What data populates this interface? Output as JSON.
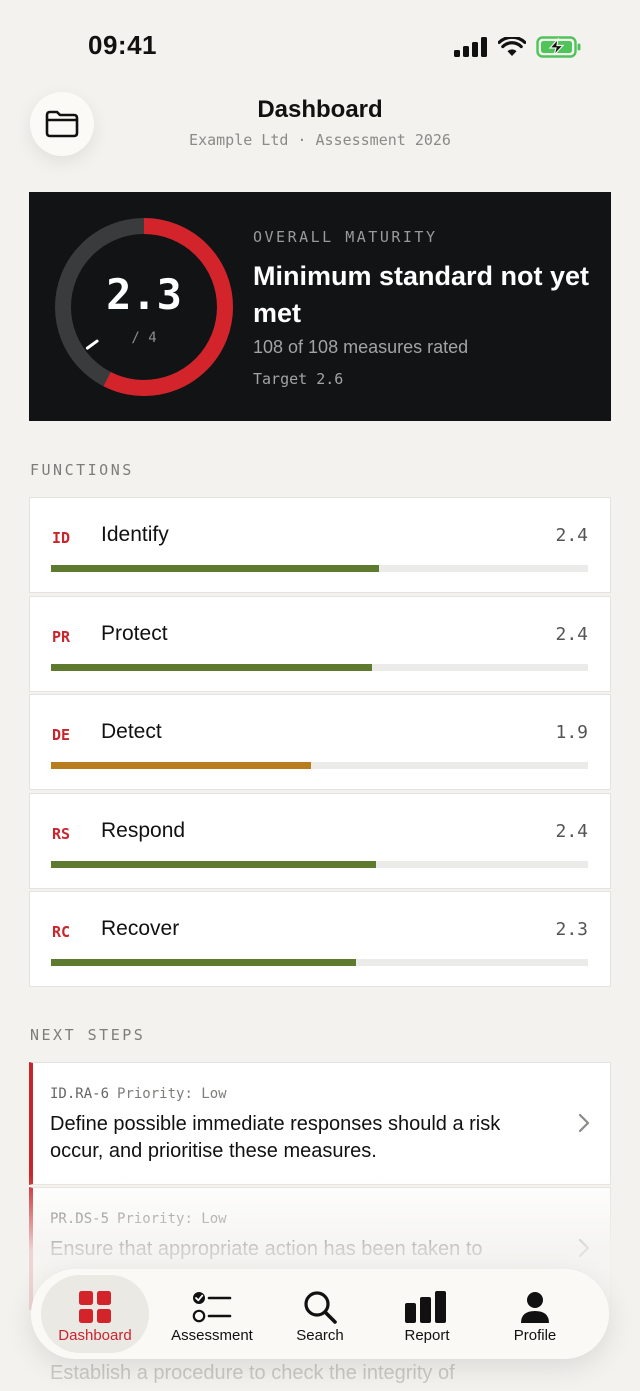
{
  "status": {
    "time": "09:41"
  },
  "header": {
    "title": "Dashboard",
    "subtitle": "Example Ltd · Assessment 2026"
  },
  "maturity": {
    "label": "OVERALL MATURITY",
    "score": "2.3",
    "score_of": "/ 4",
    "score_value": 2.3,
    "score_max": 4,
    "target_value": 2.6,
    "headline": "Minimum standard not yet met",
    "rated": "108 of 108 measures rated",
    "target": "Target 2.6"
  },
  "functions": {
    "label": "FUNCTIONS",
    "items": [
      {
        "code": "ID",
        "name": "Identify",
        "score": "2.4",
        "progress": 0.61,
        "color": "#5d7a2f"
      },
      {
        "code": "PR",
        "name": "Protect",
        "score": "2.4",
        "progress": 0.597,
        "color": "#5d7a2f"
      },
      {
        "code": "DE",
        "name": "Detect",
        "score": "1.9",
        "progress": 0.485,
        "color": "#b87d1e"
      },
      {
        "code": "RS",
        "name": "Respond",
        "score": "2.4",
        "progress": 0.605,
        "color": "#5d7a2f"
      },
      {
        "code": "RC",
        "name": "Recover",
        "score": "2.3",
        "progress": 0.568,
        "color": "#5d7a2f"
      }
    ]
  },
  "next_steps": {
    "label": "NEXT STEPS",
    "items": [
      {
        "code": "ID.RA-6",
        "priority": "Priority: Low",
        "text": "Define possible immediate responses should a risk occur, and prioritise these measures."
      },
      {
        "code": "PR.DS-5",
        "priority": "Priority: Low",
        "text": "Ensure that appropriate action has been taken to"
      }
    ],
    "partial_text": "Establish a procedure to check the integrity of"
  },
  "tabs": [
    {
      "label": "Dashboard",
      "icon": "grid-icon",
      "active": true
    },
    {
      "label": "Assessment",
      "icon": "checklist-icon",
      "active": false
    },
    {
      "label": "Search",
      "icon": "search-icon",
      "active": false
    },
    {
      "label": "Report",
      "icon": "bar-chart-icon",
      "active": false
    },
    {
      "label": "Profile",
      "icon": "person-icon",
      "active": false
    }
  ],
  "colors": {
    "accent": "#c9252c",
    "good": "#5d7a2f",
    "warn": "#b87d1e",
    "card_dark": "#121314"
  }
}
